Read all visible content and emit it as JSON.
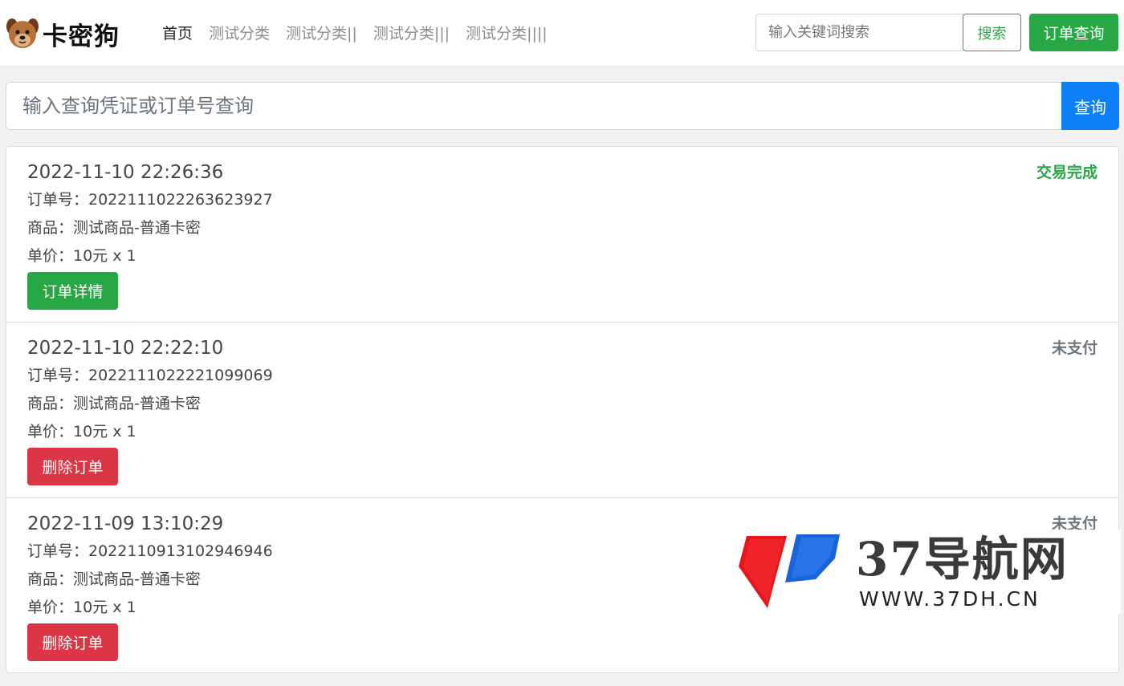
{
  "brand": {
    "name": "卡密狗",
    "logo_icon": "dog-face-icon"
  },
  "nav": {
    "items": [
      {
        "label": "首页",
        "active": true
      },
      {
        "label": "测试分类",
        "active": false
      },
      {
        "label": "测试分类||",
        "active": false
      },
      {
        "label": "测试分类|||",
        "active": false
      },
      {
        "label": "测试分类||||",
        "active": false
      }
    ]
  },
  "header": {
    "search_placeholder": "输入关键词搜索",
    "search_label": "搜索",
    "order_query_label": "订单查询"
  },
  "query": {
    "placeholder": "输入查询凭证或订单号查询",
    "button_label": "查询"
  },
  "orders": [
    {
      "time": "2022-11-10 22:26:36",
      "status": "交易完成",
      "order_no": "订单号：2022111022263623927",
      "product": "商品：测试商品-普通卡密",
      "price": "单价：10元 x 1",
      "action": "订单详情"
    },
    {
      "time": "2022-11-10 22:22:10",
      "status": "未支付",
      "order_no": "订单号：2022111022221099069",
      "product": "商品：测试商品-普通卡密",
      "price": "单价：10元 x 1",
      "action": "删除订单"
    },
    {
      "time": "2022-11-09 13:10:29",
      "status": "未支付",
      "order_no": "订单号：2022110913102946946",
      "product": "商品：测试商品-普通卡密",
      "price": "单价：10元 x 1",
      "action": "删除订单"
    }
  ],
  "watermark": {
    "title": "37导航网",
    "url": "WWW.37DH.CN"
  },
  "colors": {
    "success": "#28a745",
    "danger": "#dc3545",
    "primary": "#0d7ff7",
    "muted": "#6c757d"
  }
}
